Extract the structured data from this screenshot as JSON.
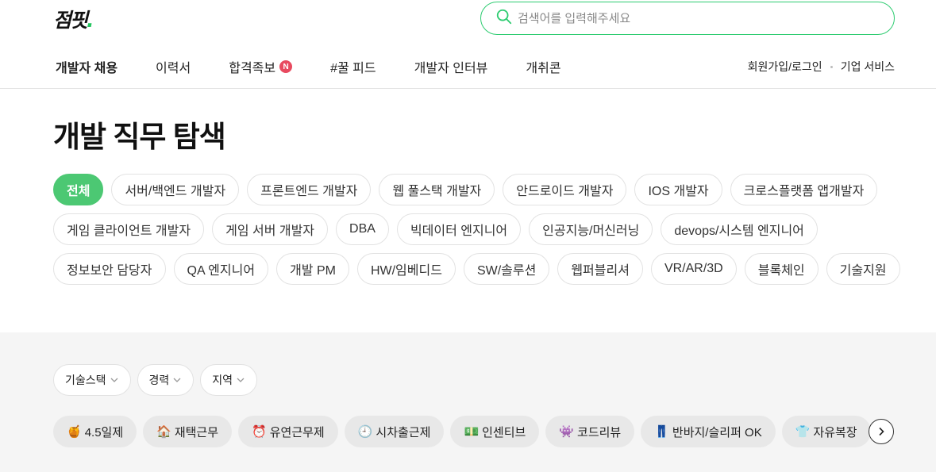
{
  "logo": {
    "text": "점핏",
    "dot": "."
  },
  "search": {
    "placeholder": "검색어를 입력해주세요",
    "value": ""
  },
  "nav": {
    "items": [
      {
        "label": "개발자 채용",
        "active": true
      },
      {
        "label": "이력서"
      },
      {
        "label": "합격족보",
        "badge": "N"
      },
      {
        "label": "#꿀 피드"
      },
      {
        "label": "개발자 인터뷰"
      },
      {
        "label": "개취콘"
      }
    ],
    "right": {
      "login": "회원가입/로그인",
      "business": "기업 서비스"
    }
  },
  "page_title": "개발 직무 탐색",
  "jobs": {
    "row1": [
      "전체",
      "서버/백엔드 개발자",
      "프론트엔드 개발자",
      "웹 풀스택 개발자",
      "안드로이드 개발자",
      "IOS 개발자",
      "크로스플랫폼 앱개발자"
    ],
    "row2": [
      "게임 클라이언트 개발자",
      "게임 서버 개발자",
      "DBA",
      "빅데이터 엔지니어",
      "인공지능/머신러닝",
      "devops/시스템 엔지니어"
    ],
    "row3": [
      "정보보안 담당자",
      "QA 엔지니어",
      "개발 PM",
      "HW/임베디드",
      "SW/솔루션",
      "웹퍼블리셔",
      "VR/AR/3D",
      "블록체인",
      "기술지원"
    ]
  },
  "filters": [
    "기술스택",
    "경력",
    "지역"
  ],
  "tags": [
    {
      "emoji": "🍯",
      "label": "4.5일제"
    },
    {
      "emoji": "🏠",
      "label": "재택근무"
    },
    {
      "emoji": "⏰",
      "label": "유연근무제"
    },
    {
      "emoji": "🕘",
      "label": "시차출근제"
    },
    {
      "emoji": "💵",
      "label": "인센티브"
    },
    {
      "emoji": "👾",
      "label": "코드리뷰"
    },
    {
      "emoji": "👖",
      "label": "반바지/슬리퍼 OK"
    },
    {
      "emoji": "👕",
      "label": "자유복장"
    },
    {
      "emoji": "",
      "label": ""
    }
  ],
  "colors": {
    "accent": "#4cc873",
    "search_border": "#2ecc71",
    "badge": "#e84a5f"
  }
}
